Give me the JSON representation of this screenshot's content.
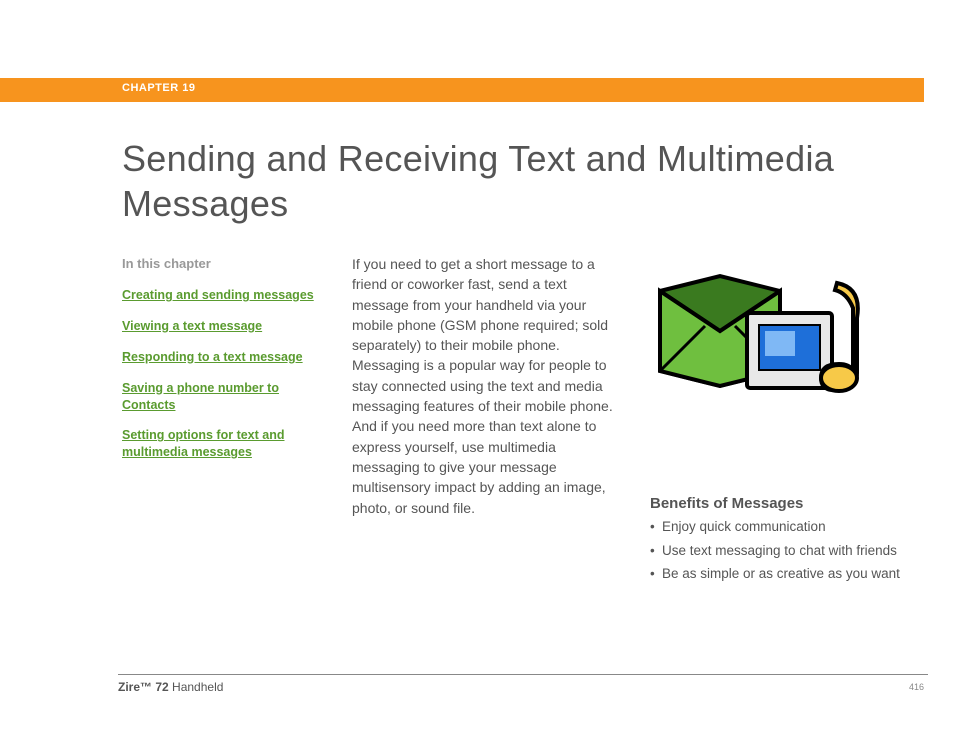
{
  "header": {
    "chapter_label": "CHAPTER 19"
  },
  "title": "Sending and Receiving Text and Multimedia Messages",
  "sidebar": {
    "heading": "In this chapter",
    "links": [
      "Creating and sending messages",
      "Viewing a text message",
      "Responding to a text message",
      "Saving a phone number to Contacts",
      "Setting options for text and multimedia messages"
    ]
  },
  "body": "If you need to get a short message to a friend or coworker fast, send a text message from your handheld via your mobile phone (GSM phone required; sold separately) to their mobile phone. Messaging is a popular way for people to stay connected using the text and media messaging features of their mobile phone. And if you need more than text alone to express yourself, use multimedia messaging to give your message multisensory impact by adding an image, photo, or sound file.",
  "benefits": {
    "title": "Benefits of Messages",
    "items": [
      "Enjoy quick communication",
      "Use text messaging to chat with friends",
      "Be as simple or as creative as you want"
    ]
  },
  "footer": {
    "product_bold": "Zire™ 72",
    "product_rest": " Handheld",
    "page": "416"
  }
}
